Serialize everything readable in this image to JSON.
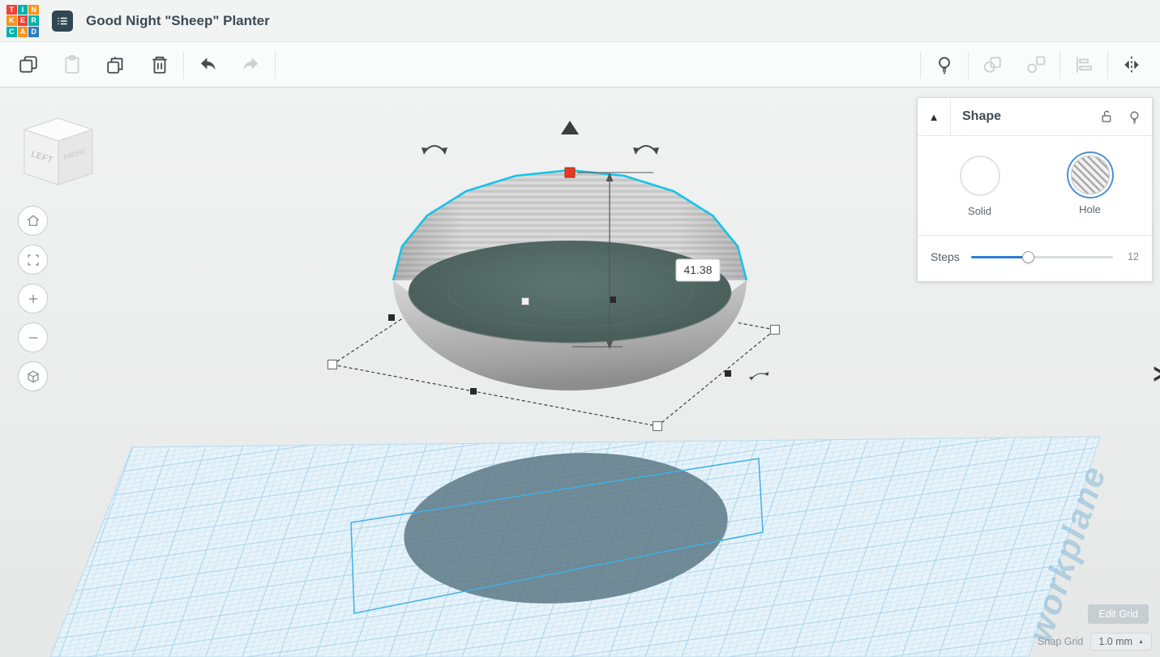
{
  "header": {
    "title": "Good Night \"Sheep\" Planter",
    "logo_letters": [
      "T",
      "I",
      "N",
      "K",
      "E",
      "R",
      "C",
      "A",
      "D"
    ],
    "menu_icon": "design-menu-icon"
  },
  "toolbar": {
    "left": [
      {
        "name": "copy",
        "enabled": true
      },
      {
        "name": "paste",
        "enabled": false
      },
      {
        "name": "duplicate",
        "enabled": true
      },
      {
        "name": "delete",
        "enabled": true
      },
      {
        "name": "undo",
        "enabled": true
      },
      {
        "name": "redo",
        "enabled": false
      }
    ],
    "right": [
      {
        "name": "show-all",
        "enabled": true
      },
      {
        "name": "group",
        "enabled": false
      },
      {
        "name": "ungroup",
        "enabled": false
      },
      {
        "name": "align",
        "enabled": false
      },
      {
        "name": "mirror",
        "enabled": true
      }
    ]
  },
  "viewcube": {
    "left_label": "LEFT",
    "front_label": "FRONT"
  },
  "nav_buttons": [
    "home-view",
    "fit-view",
    "zoom-in",
    "zoom-out",
    "orthographic-view"
  ],
  "scene": {
    "dimension_label": "41.38",
    "watermark": "workplane"
  },
  "inspector": {
    "title": "Shape",
    "materials": [
      {
        "label": "Solid",
        "selected": false
      },
      {
        "label": "Hole",
        "selected": true
      }
    ],
    "steps_label": "Steps",
    "steps_value": "12"
  },
  "grid_controls": {
    "edit_grid_label": "Edit Grid",
    "snap_grid_label": "Snap Grid",
    "snap_grid_value": "1.0 mm"
  },
  "colors": {
    "selection_cyan": "#17c3e9",
    "handle_red": "#e63a21",
    "accent_blue": "#2f7cd6",
    "workplane_line": "#a9d4ea",
    "hole_surface_teal": "#4d625d"
  }
}
